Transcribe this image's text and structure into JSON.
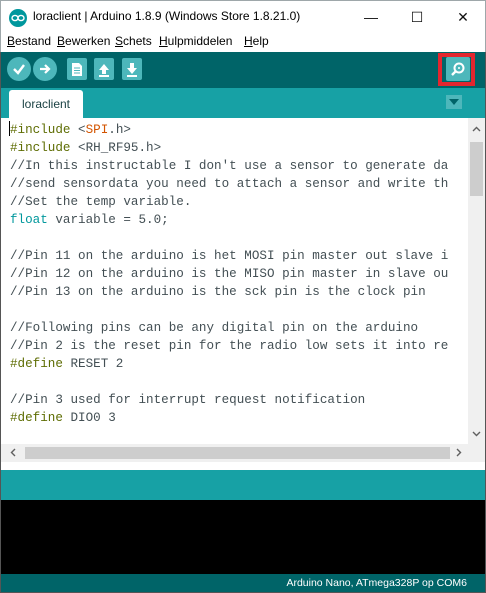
{
  "window": {
    "title": "loraclient | Arduino 1.8.9 (Windows Store 1.8.21.0)",
    "minimize_glyph": "—",
    "maximize_glyph": "☐",
    "close_glyph": "✕"
  },
  "menu": {
    "items": [
      {
        "label": "Bestand",
        "underline": "B",
        "rest": "estand"
      },
      {
        "label": "Bewerken",
        "underline": "B",
        "rest": "ewerken"
      },
      {
        "label": "Schets",
        "underline": "S",
        "rest": "chets"
      },
      {
        "label": "Hulpmiddelen",
        "underline": "H",
        "rest": "ulpmiddelen"
      },
      {
        "label": "Help",
        "underline": "H",
        "rest": "elp"
      }
    ]
  },
  "toolbar": {
    "buttons": [
      "verify-icon",
      "upload-icon",
      "new-icon",
      "open-icon",
      "save-icon"
    ],
    "serial_monitor": "serial-monitor-icon",
    "accent": "#4db7bb",
    "highlight_color": "#e3262f"
  },
  "tabs": {
    "active": "loraclient"
  },
  "editor": {
    "lines": [
      {
        "parts": [
          {
            "t": "#include",
            "c": "kw-dir"
          },
          {
            "t": " <",
            "c": ""
          },
          {
            "t": "SPI",
            "c": "kw-lib"
          },
          {
            "t": ".h>",
            "c": ""
          }
        ]
      },
      {
        "parts": [
          {
            "t": "#include",
            "c": "kw-dir"
          },
          {
            "t": " <RH_RF95.h>",
            "c": ""
          }
        ]
      },
      {
        "parts": [
          {
            "t": "//In this instructable I don't use a sensor to generate da",
            "c": "cmt"
          }
        ]
      },
      {
        "parts": [
          {
            "t": "//send sensordata you need to attach a sensor and write th",
            "c": "cmt"
          }
        ]
      },
      {
        "parts": [
          {
            "t": "//Set the temp variable.",
            "c": "cmt"
          }
        ]
      },
      {
        "parts": [
          {
            "t": "float",
            "c": "kw-type"
          },
          {
            "t": " variable = 5.0;",
            "c": ""
          }
        ]
      },
      {
        "parts": [
          {
            "t": "",
            "c": ""
          }
        ]
      },
      {
        "parts": [
          {
            "t": "//Pin 11 on the arduino is het MOSI pin master out slave i",
            "c": "cmt"
          }
        ]
      },
      {
        "parts": [
          {
            "t": "//Pin 12 on the arduino is the MISO pin master in slave ou",
            "c": "cmt"
          }
        ]
      },
      {
        "parts": [
          {
            "t": "//Pin 13 on the arduino is the sck pin is the clock pin",
            "c": "cmt"
          }
        ]
      },
      {
        "parts": [
          {
            "t": "",
            "c": ""
          }
        ]
      },
      {
        "parts": [
          {
            "t": "//Following pins can be any digital pin on the arduino",
            "c": "cmt"
          }
        ]
      },
      {
        "parts": [
          {
            "t": "//Pin 2 is the reset pin for the radio low sets it into re",
            "c": "cmt"
          }
        ]
      },
      {
        "parts": [
          {
            "t": "#define",
            "c": "kw-dir"
          },
          {
            "t": " RESET 2",
            "c": ""
          }
        ]
      },
      {
        "parts": [
          {
            "t": "",
            "c": ""
          }
        ]
      },
      {
        "parts": [
          {
            "t": "//Pin 3 used for interrupt request notification",
            "c": "cmt"
          }
        ]
      },
      {
        "parts": [
          {
            "t": "#define",
            "c": "kw-dir"
          },
          {
            "t": " DIO0 3",
            "c": ""
          }
        ]
      }
    ]
  },
  "status": {
    "board": "Arduino Nano, ATmega328P op COM6"
  }
}
